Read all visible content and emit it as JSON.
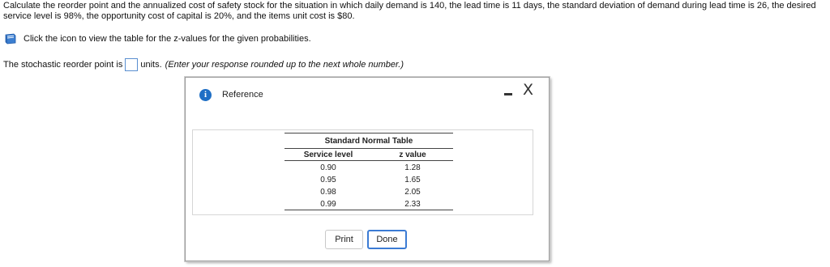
{
  "question": {
    "text": "Calculate the reorder point and the annualized cost of safety stock for the situation in which daily demand is 140, the lead time is 11 days, the standard deviation of demand during lead time is 26, the desired service level is 98%, the opportunity cost of capital is 20%, and the items unit cost is $80."
  },
  "hint": {
    "icon": "book-icon",
    "text": "Click the icon to view the table for the z-values for the given probabilities."
  },
  "answer": {
    "prefix": "The stochastic reorder point is",
    "value": "",
    "suffix": "units.",
    "instruction": "(Enter your response rounded up to the next whole number.)"
  },
  "dialog": {
    "title": "Reference",
    "icons": [
      "info-icon",
      "minimize-icon",
      "close-icon"
    ],
    "close_glyph": "X",
    "table": {
      "caption": "Standard Normal Table",
      "headers": [
        "Service level",
        "z value"
      ],
      "rows": [
        [
          "0.90",
          "1.28"
        ],
        [
          "0.95",
          "1.65"
        ],
        [
          "0.98",
          "2.05"
        ],
        [
          "0.99",
          "2.33"
        ]
      ]
    },
    "buttons": {
      "print": "Print",
      "done": "Done"
    }
  },
  "colors": {
    "accent": "#1f6fc5",
    "focus": "#3b7bd4"
  }
}
